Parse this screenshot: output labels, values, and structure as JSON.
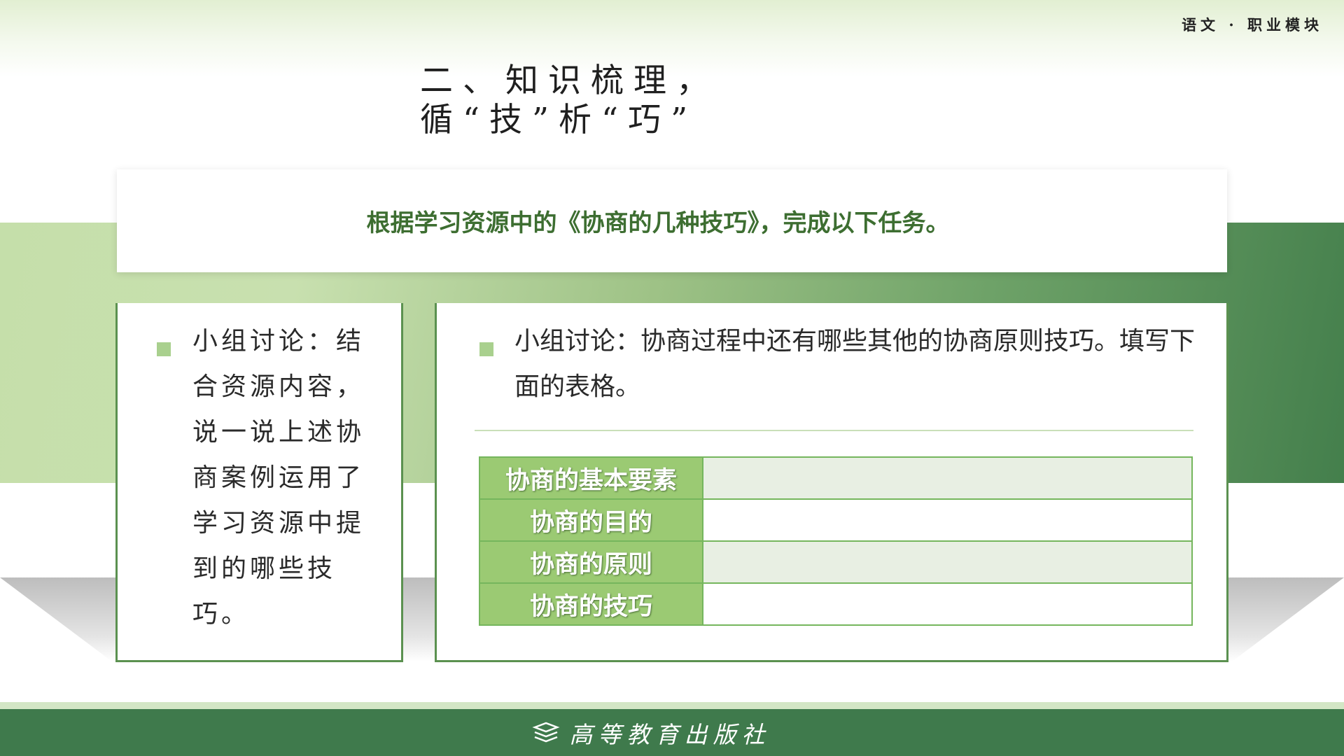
{
  "header": {
    "module_label": "语文 · 职业模块",
    "title": "二、知识梳理，循“技”析“巧”"
  },
  "instruction": {
    "text": "根据学习资源中的《协商的几种技巧》，完成以下任务。"
  },
  "left_panel": {
    "text": "小组讨论：结合资源内容，说一说上述协商案例运用了学习资源中提到的哪些技巧。"
  },
  "right_panel": {
    "text": "小组讨论：协商过程中还有哪些其他的协商原则技巧。填写下面的表格。",
    "table": {
      "rows": [
        {
          "label": "协商的基本要素",
          "value": ""
        },
        {
          "label": "协商的目的",
          "value": ""
        },
        {
          "label": "协商的原则",
          "value": ""
        },
        {
          "label": "协商的技巧",
          "value": ""
        }
      ]
    }
  },
  "footer": {
    "publisher": "高等教育出版社",
    "icon": "book-stack-icon"
  },
  "colors": {
    "accent_green": "#3f7a4c",
    "instruction_text": "#3d6e31",
    "table_label_bg": "#9bca73",
    "bullet": "#a9d08e"
  }
}
